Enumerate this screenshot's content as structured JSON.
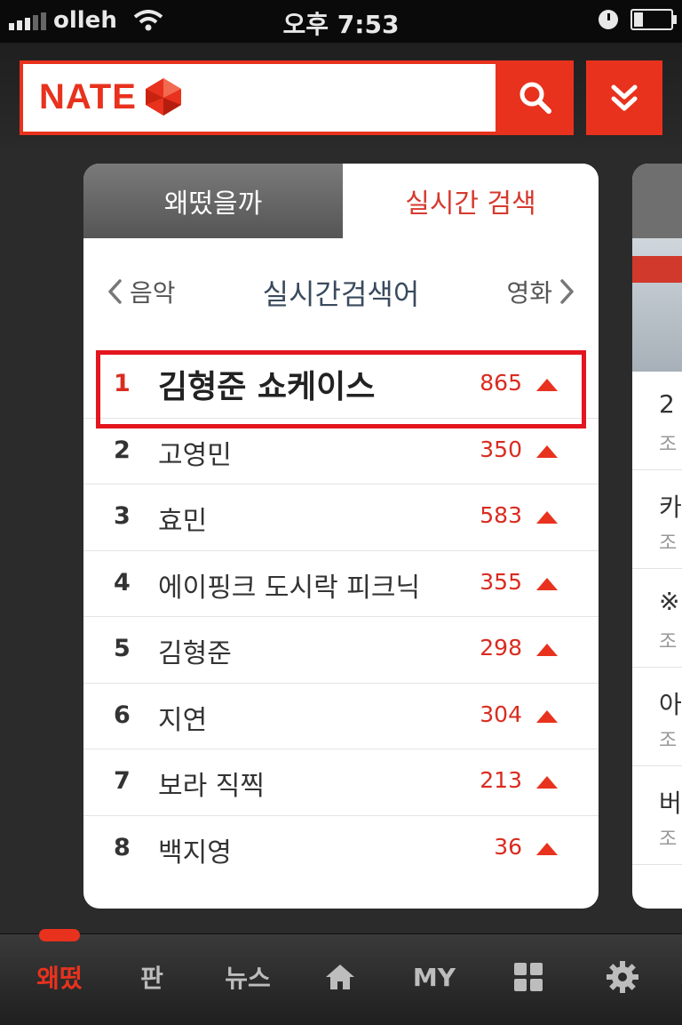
{
  "status_bar": {
    "carrier": "olleh",
    "time": "오후 7:53"
  },
  "header": {
    "logo_text": "NATE",
    "search_icon": "search-icon",
    "menu_icon": "double-chevron-down-icon"
  },
  "tabs": {
    "inactive": "왜떴을까",
    "active": "실시간 검색"
  },
  "category": {
    "prev": "음악",
    "title": "실시간검색어",
    "next": "영화"
  },
  "rankings": [
    {
      "rank": "1",
      "keyword": "김형준 쇼케이스",
      "count": "865"
    },
    {
      "rank": "2",
      "keyword": "고영민",
      "count": "350"
    },
    {
      "rank": "3",
      "keyword": "효민",
      "count": "583"
    },
    {
      "rank": "4",
      "keyword": "에이핑크 도시락 피크닉",
      "count": "355"
    },
    {
      "rank": "5",
      "keyword": "김형준",
      "count": "298"
    },
    {
      "rank": "6",
      "keyword": "지연",
      "count": "304"
    },
    {
      "rank": "7",
      "keyword": "보라 직찍",
      "count": "213"
    },
    {
      "rank": "8",
      "keyword": "백지영",
      "count": "36"
    }
  ],
  "peek_card": {
    "rows": [
      {
        "title": "2",
        "sub": "조"
      },
      {
        "title": "카",
        "sub": "조"
      },
      {
        "title": "※",
        "sub": "조"
      },
      {
        "title": "아",
        "sub": "조"
      },
      {
        "title": "버",
        "sub": "조"
      }
    ]
  },
  "tab_bar": {
    "item1": "왜떴",
    "item2": "판",
    "item3": "뉴스",
    "item5": "MY"
  },
  "colors": {
    "accent": "#e8321e",
    "rank_count": "#d92c20"
  }
}
